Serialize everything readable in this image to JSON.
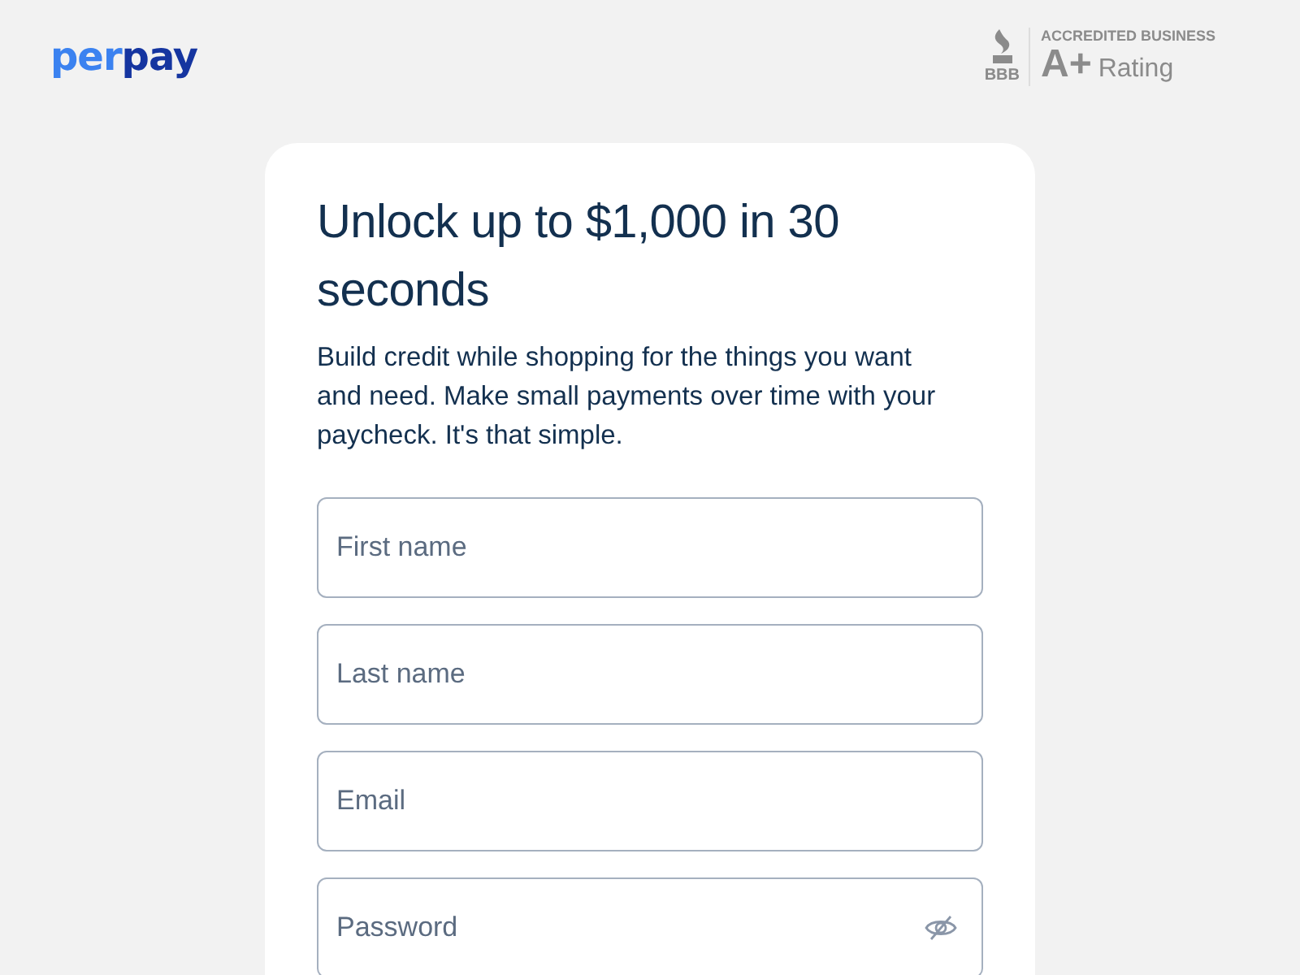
{
  "header": {
    "logo": {
      "light_part": "per",
      "dark_part": "pay"
    },
    "bbb_badge": {
      "mark": "BBB",
      "caption": "ACCREDITED BUSINESS",
      "grade": "A+",
      "label": "Rating"
    }
  },
  "card": {
    "title": "Unlock up to $1,000 in 30 seconds",
    "description": "Build credit while shopping for the things you want and need. Make small payments over time with your paycheck. It's that simple.",
    "fields": [
      {
        "placeholder": "First name",
        "kind": "text"
      },
      {
        "placeholder": "Last name",
        "kind": "text"
      },
      {
        "placeholder": "Email",
        "kind": "email"
      },
      {
        "placeholder": "Password",
        "kind": "password"
      }
    ]
  }
}
